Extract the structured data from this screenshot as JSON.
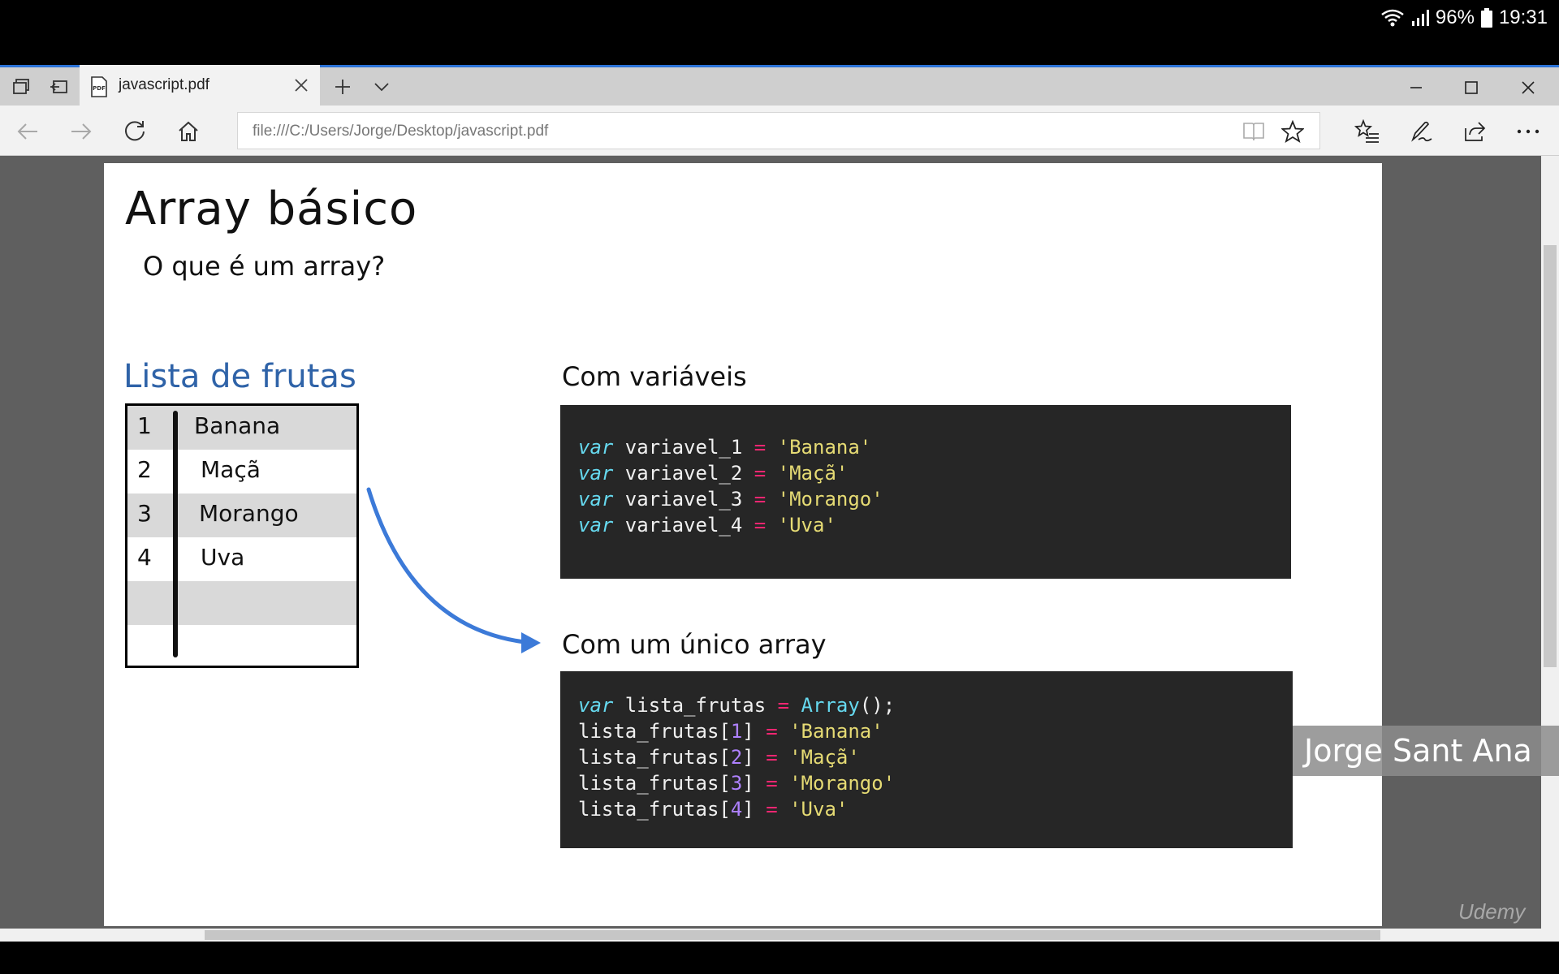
{
  "status": {
    "battery": "96%",
    "time": "19:31"
  },
  "tab": {
    "title": "javascript.pdf"
  },
  "address": {
    "url": "file:///C:/Users/Jorge/Desktop/javascript.pdf"
  },
  "slide": {
    "title": "Array básico",
    "subtitle": "O que é um array?",
    "list_heading": "Lista de frutas",
    "fruits": [
      {
        "num": "1",
        "name": "Banana"
      },
      {
        "num": "2",
        "name": "Maçã"
      },
      {
        "num": "3",
        "name": "Morango"
      },
      {
        "num": "4",
        "name": "Uva"
      }
    ],
    "heading_vars": "Com variáveis",
    "heading_array": "Com um único array",
    "code_vars": [
      {
        "kw": "var",
        "name": " variavel_1 ",
        "op": "=",
        "str": " 'Banana'"
      },
      {
        "kw": "var",
        "name": " variavel_2 ",
        "op": "=",
        "str": " 'Maçã'"
      },
      {
        "kw": "var",
        "name": " variavel_3 ",
        "op": "=",
        "str": " 'Morango'"
      },
      {
        "kw": "var",
        "name": " variavel_4 ",
        "op": "=",
        "str": " 'Uva'"
      }
    ],
    "code_array_first": {
      "kw": "var",
      "name": " lista_frutas ",
      "op": "=",
      "fn": " Array",
      "rest": "();"
    },
    "code_array": [
      {
        "pre": "lista_frutas[",
        "idx": "1",
        "post": "] ",
        "op": "=",
        "str": " 'Banana'"
      },
      {
        "pre": "lista_frutas[",
        "idx": "2",
        "post": "] ",
        "op": "=",
        "str": " 'Maçã'"
      },
      {
        "pre": "lista_frutas[",
        "idx": "3",
        "post": "] ",
        "op": "=",
        "str": " 'Morango'"
      },
      {
        "pre": "lista_frutas[",
        "idx": "4",
        "post": "] ",
        "op": "=",
        "str": " 'Uva'"
      }
    ]
  },
  "presenter": "Jorge Sant Ana",
  "watermark": "Udemy",
  "colors": {
    "accent": "#2b73d8",
    "list_heading": "#2f63a8",
    "code_bg": "#262626",
    "arrow": "#3c7ad8"
  },
  "icons": {
    "tab_preview": "tab-preview-icon",
    "set_aside": "set-aside-tabs-icon",
    "pdf": "pdf-file-icon",
    "close": "close-icon",
    "new_tab": "plus-icon",
    "tab_menu": "chevron-down-icon",
    "back": "back-arrow-icon",
    "forward": "forward-arrow-icon",
    "refresh": "refresh-icon",
    "home": "home-icon",
    "reading": "reading-view-icon",
    "favorite": "star-icon",
    "hub": "favorites-hub-icon",
    "notes": "pen-icon",
    "share": "share-icon",
    "more": "more-icon"
  }
}
